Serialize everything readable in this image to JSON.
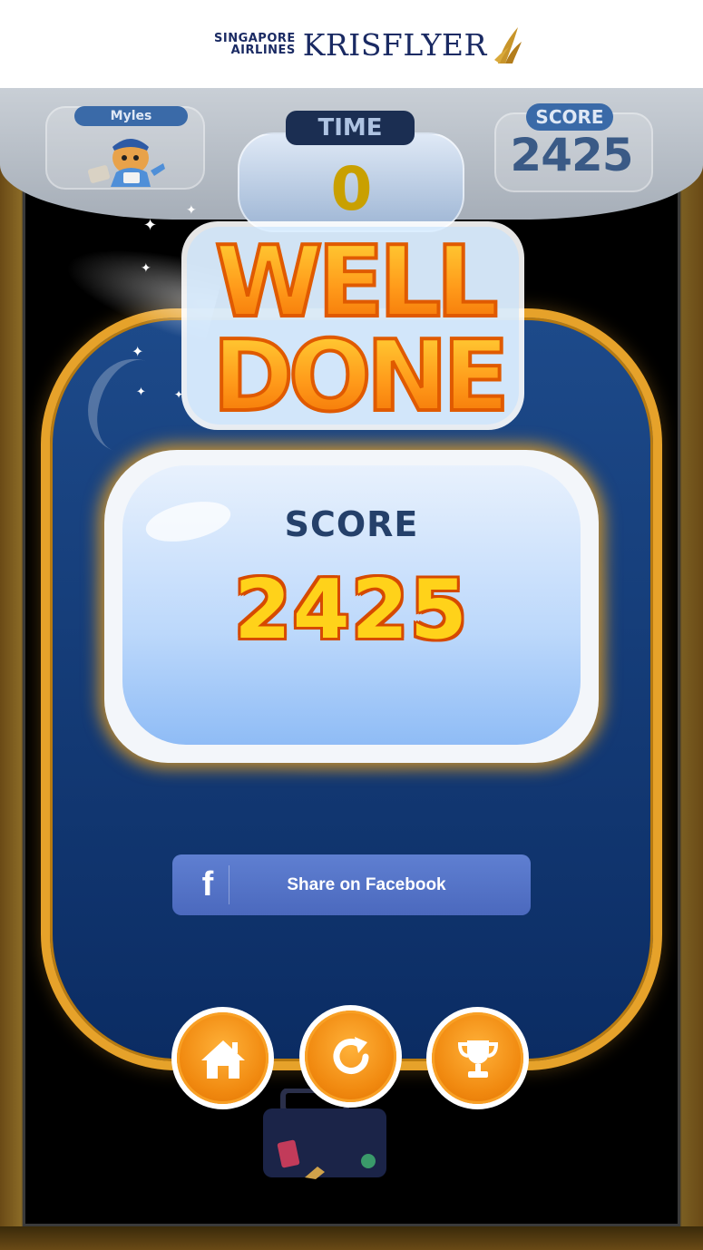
{
  "header": {
    "brand_airline_line1": "SINGAPORE",
    "brand_airline_line2": "AIRLINES",
    "brand_program": "KRISFLYER"
  },
  "hud": {
    "player_name": "Myles",
    "time_label": "TIME",
    "time_value": "0",
    "score_label": "SCORE",
    "score_value": "2425"
  },
  "result": {
    "heading_line1": "WELL",
    "heading_line2": "DONE",
    "score_label": "SCORE",
    "score_value": "2425"
  },
  "share": {
    "facebook_icon": "f",
    "facebook_label": "Share on Facebook"
  },
  "actions": {
    "home_icon": "home-icon",
    "replay_icon": "replay-icon",
    "leaderboard_icon": "trophy-icon"
  },
  "colors": {
    "navy": "#1a2a63",
    "panel_blue": "#0b2c63",
    "orange": "#f18a10",
    "gold_border": "#e6a22a",
    "facebook_blue": "#4b69be",
    "score_yellow": "#ffd21a"
  }
}
